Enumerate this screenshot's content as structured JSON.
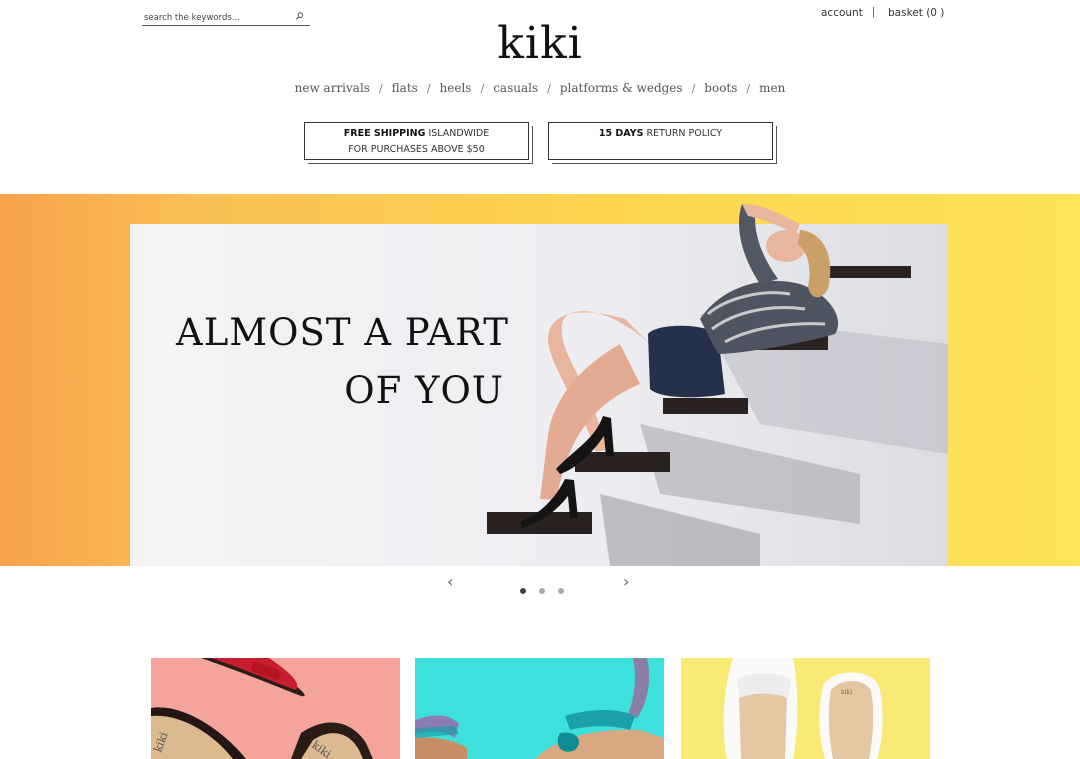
{
  "search": {
    "placeholder": "search the keywords..."
  },
  "header": {
    "account": "account",
    "separator": "|",
    "basket": "basket (0 )",
    "logo": "kiki"
  },
  "nav": {
    "items": [
      "new arrivals",
      "flats",
      "heels",
      "casuals",
      "platforms & wedges",
      "boots",
      "men"
    ],
    "separator": "/"
  },
  "promos": [
    {
      "bold": "FREE SHIPPING",
      "rest": " ISLANDWIDE",
      "line2": "FOR PURCHASES ABOVE $50"
    },
    {
      "bold": "15 DAYS",
      "rest": " RETURN POLICY",
      "line2": ""
    }
  ],
  "hero": {
    "line1": "ALMOST A PART",
    "line2": "OF YOU",
    "slides": 3,
    "active_slide": 1
  },
  "carousel": {
    "prev_icon": "chevron-left-icon",
    "next_icon": "chevron-right-icon",
    "prev_glyph": "‹",
    "next_glyph": "›"
  },
  "tiles": [
    {
      "name": "tile-flats",
      "color": "#f4a49a",
      "shoe_text": "kiki"
    },
    {
      "name": "tile-sandals",
      "color": "#3de0da"
    },
    {
      "name": "tile-loafers",
      "color": "#f9ea75",
      "shoe_text": "kiki"
    }
  ],
  "colors": {
    "hero_left": "#f7a24e",
    "hero_right": "#fde45a",
    "text": "#333333"
  }
}
